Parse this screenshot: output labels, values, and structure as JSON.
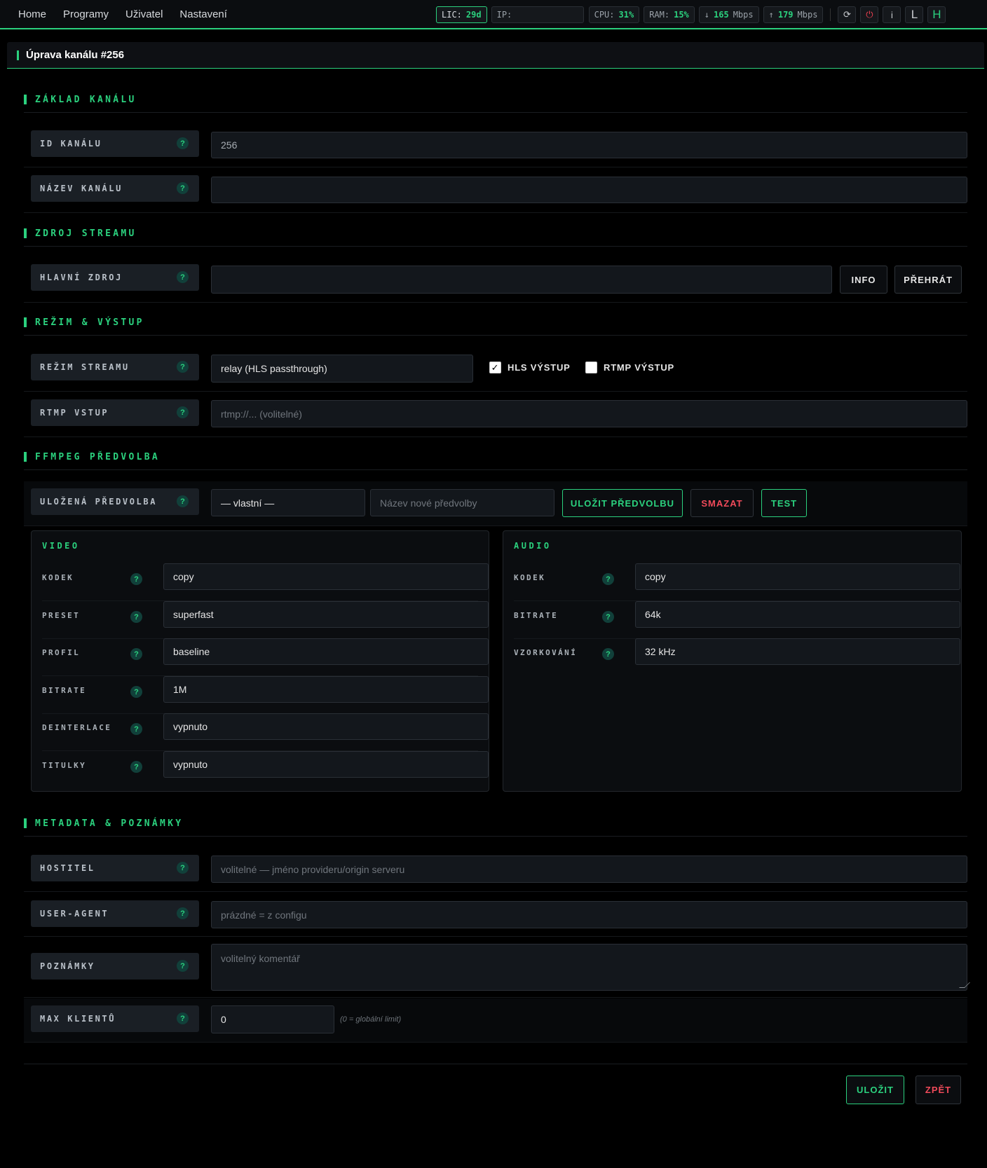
{
  "nav": [
    "Home",
    "Programy",
    "Uživatel",
    "Nastavení"
  ],
  "stats": {
    "lic_label": "LIC:",
    "lic_value": "29d",
    "ip_label": "IP:",
    "cpu_label": "CPU:",
    "cpu_value": "31%",
    "ram_label": "RAM:",
    "ram_value": "15%",
    "down_arrow": "↓",
    "down_value": "165",
    "down_unit": "Mbps",
    "up_arrow": "↑",
    "up_value": "179",
    "up_unit": "Mbps"
  },
  "toolbar": {
    "refresh": "⟳",
    "power": "⏻",
    "info": "i",
    "l": "L",
    "h": "H"
  },
  "panel": {
    "title": "Úprava kanálu #256"
  },
  "sections": {
    "basic": "ZÁKLAD KANÁLU",
    "source": "ZDROJ STREAMU",
    "mode": "REŽIM & VÝSTUP",
    "ffmpeg": "FFMPEG PŘEDVOLBA",
    "meta": "METADATA & POZNÁMKY"
  },
  "help": "?",
  "fields": {
    "channel_id": {
      "label": "ID KANÁLU",
      "value": "256"
    },
    "channel_name": {
      "label": "NÁZEV KANÁLU",
      "value": ""
    },
    "main_source": {
      "label": "HLAVNÍ ZDROJ",
      "value": ""
    },
    "stream_mode": {
      "label": "REŽIM STREAMU",
      "value": "relay (HLS passthrough)"
    },
    "rtmp_input": {
      "label": "RTMP VSTUP",
      "placeholder": "rtmp://... (volitelné)"
    },
    "saved_preset": {
      "label": "ULOŽENÁ PŘEDVOLBA",
      "value": "— vlastní —",
      "name_placeholder": "Název nové předvolby"
    },
    "host": {
      "label": "HOSTITEL",
      "placeholder": "volitelné — jméno provideru/origin serveru"
    },
    "user_agent": {
      "label": "USER-AGENT",
      "placeholder": "prázdné = z configu"
    },
    "notes": {
      "label": "POZNÁMKY",
      "placeholder": "volitelný komentář"
    },
    "max_clients": {
      "label": "MAX KLIENTŮ",
      "value": "0",
      "hint": "(0 = globální limit)"
    }
  },
  "buttons": {
    "info": "INFO",
    "play": "PŘEHRÁT",
    "save_preset": "ULOŽIT PŘEDVOLBU",
    "delete": "SMAZAT",
    "test": "TEST",
    "save": "ULOŽIT",
    "back": "ZPĚT"
  },
  "checks": {
    "hls": {
      "label": "HLS VÝSTUP",
      "checked": true
    },
    "rtmp": {
      "label": "RTMP VÝSTUP",
      "checked": false
    }
  },
  "video": {
    "title": "VIDEO",
    "rows": [
      {
        "label": "KODEK",
        "value": "copy"
      },
      {
        "label": "PRESET",
        "value": "superfast"
      },
      {
        "label": "PROFIL",
        "value": "baseline"
      },
      {
        "label": "BITRATE",
        "value": "1M"
      },
      {
        "label": "DEINTERLACE",
        "value": "vypnuto"
      },
      {
        "label": "TITULKY",
        "value": "vypnuto"
      }
    ]
  },
  "audio": {
    "title": "AUDIO",
    "rows": [
      {
        "label": "KODEK",
        "value": "copy"
      },
      {
        "label": "BITRATE",
        "value": "64k"
      },
      {
        "label": "VZORKOVÁNÍ",
        "value": "32 kHz"
      }
    ]
  },
  "colors": {
    "accent": "#2bd17e",
    "danger": "#f04a5a",
    "background": "#000000"
  }
}
